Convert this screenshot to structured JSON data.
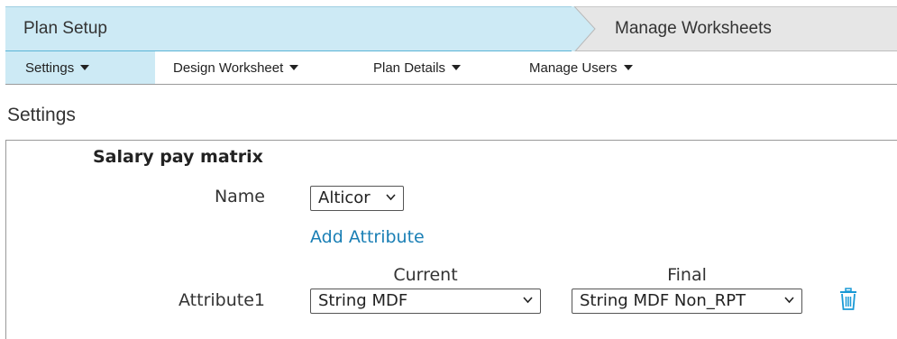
{
  "wizard": {
    "steps": [
      {
        "label": "Plan Setup",
        "active": true
      },
      {
        "label": "Manage Worksheets",
        "active": false
      }
    ]
  },
  "subnav": {
    "items": [
      {
        "label": "Settings",
        "active": true
      },
      {
        "label": "Design Worksheet",
        "active": false
      },
      {
        "label": "Plan Details",
        "active": false
      },
      {
        "label": "Manage Users",
        "active": false
      }
    ]
  },
  "page": {
    "title": "Settings"
  },
  "panel": {
    "section_title": "Salary pay matrix",
    "name_label": "Name",
    "name_value": "Alticor",
    "add_attribute_label": "Add Attribute",
    "columns": {
      "current": "Current",
      "final": "Final"
    },
    "attributes": [
      {
        "label": "Attribute1",
        "current": "String MDF",
        "final": "String MDF Non_RPT"
      }
    ]
  },
  "colors": {
    "accent": "#1a7fb5",
    "active_tab": "#cdeaf5"
  },
  "icons": {
    "delete": "trash-icon",
    "dropdown": "chevron-down-icon",
    "menu_caret": "caret-down-icon"
  }
}
